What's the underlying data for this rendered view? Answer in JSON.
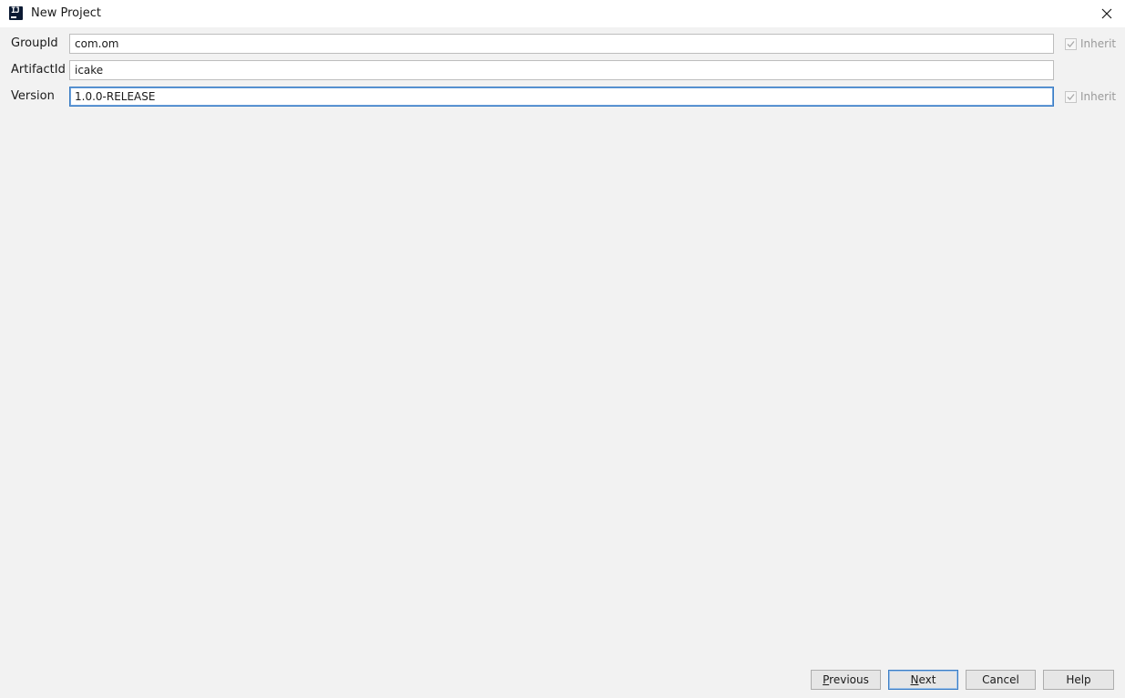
{
  "window": {
    "title": "New Project",
    "app_icon": "intellij-icon",
    "close_icon": "close-icon"
  },
  "form": {
    "group_id": {
      "label": "GroupId",
      "value": "com.om",
      "inherit_label": "Inherit",
      "inherit_checked": true
    },
    "artifact_id": {
      "label": "ArtifactId",
      "value": "icake"
    },
    "version": {
      "label": "Version",
      "value": "1.0.0-RELEASE",
      "inherit_label": "Inherit",
      "inherit_checked": true
    }
  },
  "buttons": {
    "previous": {
      "mnemonic": "P",
      "rest": "revious"
    },
    "next": {
      "mnemonic": "N",
      "rest": "ext"
    },
    "cancel": "Cancel",
    "help": "Help"
  },
  "colors": {
    "background": "#f2f2f2",
    "focus_border": "#3a7cc4"
  }
}
